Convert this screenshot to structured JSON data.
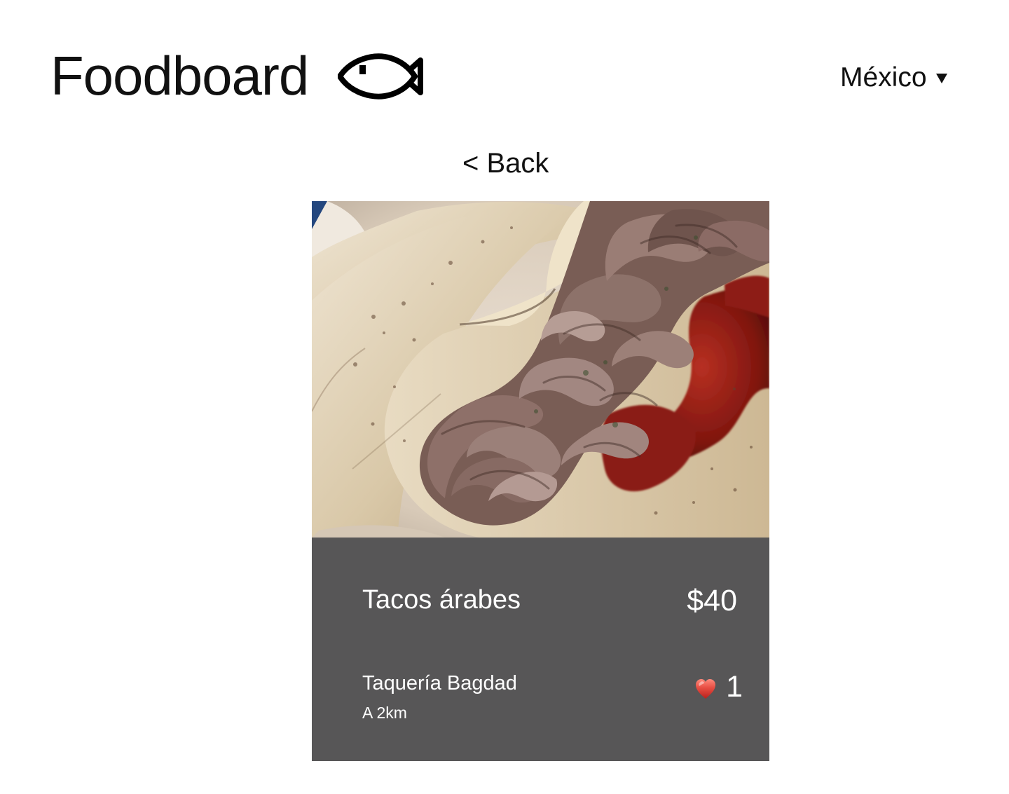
{
  "header": {
    "title": "Foodboard",
    "logo_icon": "fish-icon",
    "country_selector": {
      "selected": "México",
      "icon": "chevron-down-icon"
    }
  },
  "navigation": {
    "back_label": "< Back"
  },
  "dish_card": {
    "image_description_icon": "taco-photo",
    "name": "Tacos árabes",
    "price": "$40",
    "restaurant": "Taquería Bagdad",
    "distance": "A 2km",
    "likes": {
      "icon": "heart-icon",
      "count": "1"
    },
    "colors": {
      "panel_background": "#575657",
      "panel_text": "#ffffff",
      "heart": "#d93b37"
    }
  }
}
